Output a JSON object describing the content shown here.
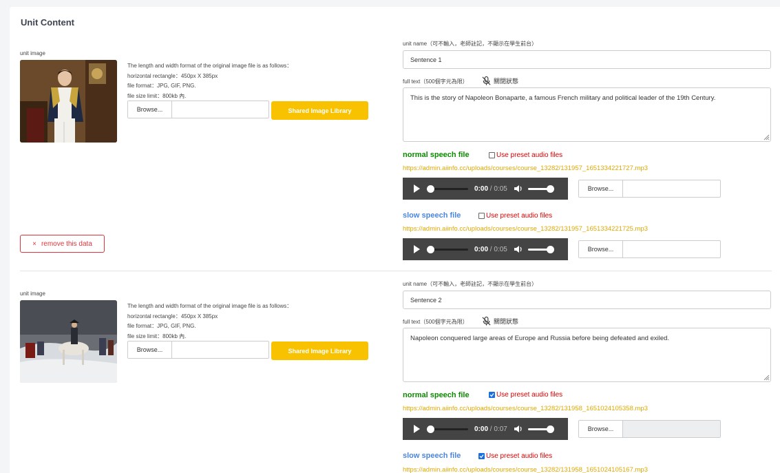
{
  "card": {
    "title": "Unit Content"
  },
  "units": [
    {
      "image_label": "unit image",
      "image_desc": {
        "line1": "The length and width format of the original image file is as follows：",
        "line2": "horizontal rectangle：450px X 385px",
        "line3": "file format：JPG, GIF, PNG.",
        "line4": "file size limit：800kb 內."
      },
      "browse_label": "Browse...",
      "library_button": "Shared Image Library",
      "unit_name_label": "unit name（可不輸入，老師註記，不顯示在學生前台）",
      "unit_name_value": "Sentence 1",
      "full_text_label": "full text（500個字元為限）",
      "mic_status": "關閉狀態",
      "full_text_value": "This is the story of Napoleon Bonaparte, a famous French military and political leader of the 19th Century.",
      "normal": {
        "title": "normal speech file",
        "preset_label": "Use preset audio files",
        "preset_checked": false,
        "url": "https://admin.aiinfo.cc/uploads/courses/course_13282/131957_1651334221727.mp3",
        "time": "0:00",
        "duration": " / 0:05",
        "browse_label": "Browse..."
      },
      "slow": {
        "title": "slow speech file",
        "preset_label": "Use preset audio files",
        "preset_checked": false,
        "url": "https://admin.aiinfo.cc/uploads/courses/course_13282/131957_1651334221725.mp3",
        "time": "0:00",
        "duration": " / 0:05",
        "browse_label": "Browse..."
      },
      "remove_label": "remove this data"
    },
    {
      "image_label": "unit image",
      "image_desc": {
        "line1": "The length and width format of the original image file is as follows：",
        "line2": "horizontal rectangle：450px X 385px",
        "line3": "file format：JPG, GIF, PNG.",
        "line4": "file size limit：800kb 內."
      },
      "browse_label": "Browse...",
      "library_button": "Shared Image Library",
      "unit_name_label": "unit name（可不輸入，老師註記，不顯示在學生前台）",
      "unit_name_value": "Sentence 2",
      "full_text_label": "full text（500個字元為限）",
      "mic_status": "關閉狀態",
      "full_text_value": "Napoleon conquered large areas of Europe and Russia before being defeated and exiled.",
      "normal": {
        "title": "normal speech file",
        "preset_label": "Use preset audio files",
        "preset_checked": true,
        "url": "https://admin.aiinfo.cc/uploads/courses/course_13282/131958_1651024105358.mp3",
        "time": "0:00",
        "duration": " / 0:07",
        "browse_label": "Browse..."
      },
      "slow": {
        "title": "slow speech file",
        "preset_label": "Use preset audio files",
        "preset_checked": true,
        "url": "https://admin.aiinfo.cc/uploads/courses/course_13282/131958_1651024105167.mp3"
      }
    }
  ]
}
